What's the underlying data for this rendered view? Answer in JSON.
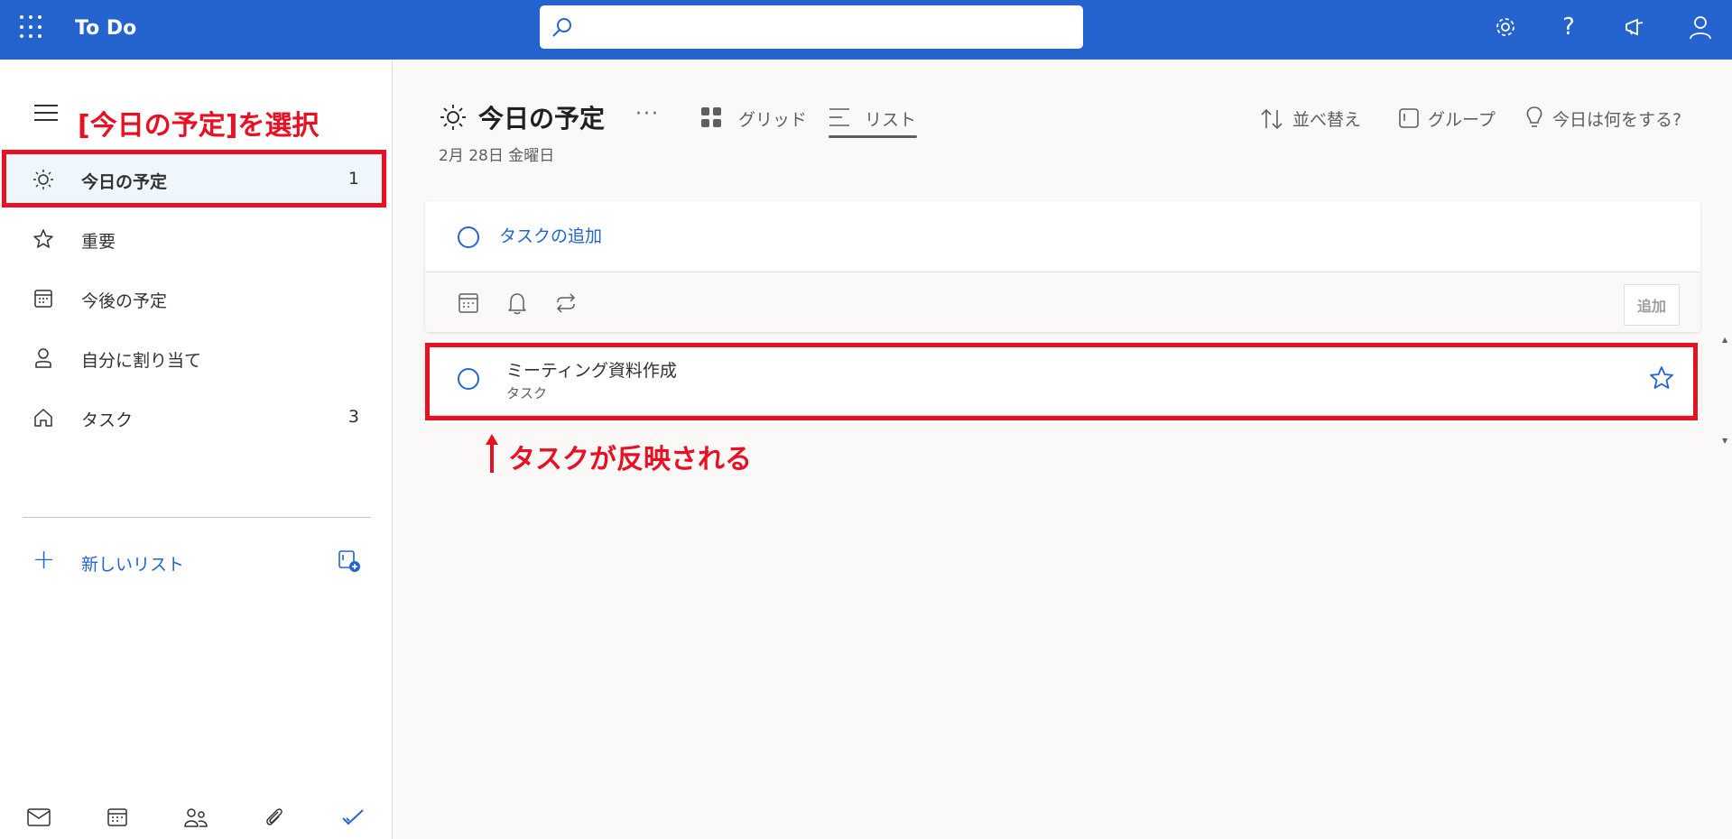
{
  "header": {
    "app_title": "To Do",
    "search_placeholder": "",
    "icons": [
      "waffle-icon",
      "search-icon",
      "settings-icon",
      "help-icon",
      "feedback-icon",
      "account-icon"
    ]
  },
  "sidebar": {
    "annotation": "[今日の予定]を選択",
    "items": [
      {
        "label": "今日の予定",
        "count": "1",
        "icon": "sun-icon"
      },
      {
        "label": "重要",
        "count": "",
        "icon": "star-icon"
      },
      {
        "label": "今後の予定",
        "count": "",
        "icon": "calendar-icon"
      },
      {
        "label": "自分に割り当て",
        "count": "",
        "icon": "person-icon"
      },
      {
        "label": "タスク",
        "count": "3",
        "icon": "home-icon"
      }
    ],
    "new_list_label": "新しいリスト",
    "bottom_apps": [
      "mail-icon",
      "calendar-icon",
      "people-icon",
      "attach-icon",
      "todo-check-icon"
    ]
  },
  "main": {
    "title": "今日の予定",
    "more": "···",
    "date": "2月 28日 金曜日",
    "view_tabs": [
      {
        "label": "グリッド",
        "active": false
      },
      {
        "label": "リスト",
        "active": true
      }
    ],
    "actions": {
      "sort": "並べ替え",
      "group": "グループ",
      "suggest": "今日は何をする?"
    },
    "add_task": {
      "placeholder": "タスクの追加",
      "add_button": "追加"
    },
    "tasks": [
      {
        "title": "ミーティング資料作成",
        "list": "タスク",
        "important": false
      }
    ],
    "annotation": "タスクが反映される"
  },
  "colors": {
    "brand": "#2564cf",
    "annotation": "#e81123"
  }
}
